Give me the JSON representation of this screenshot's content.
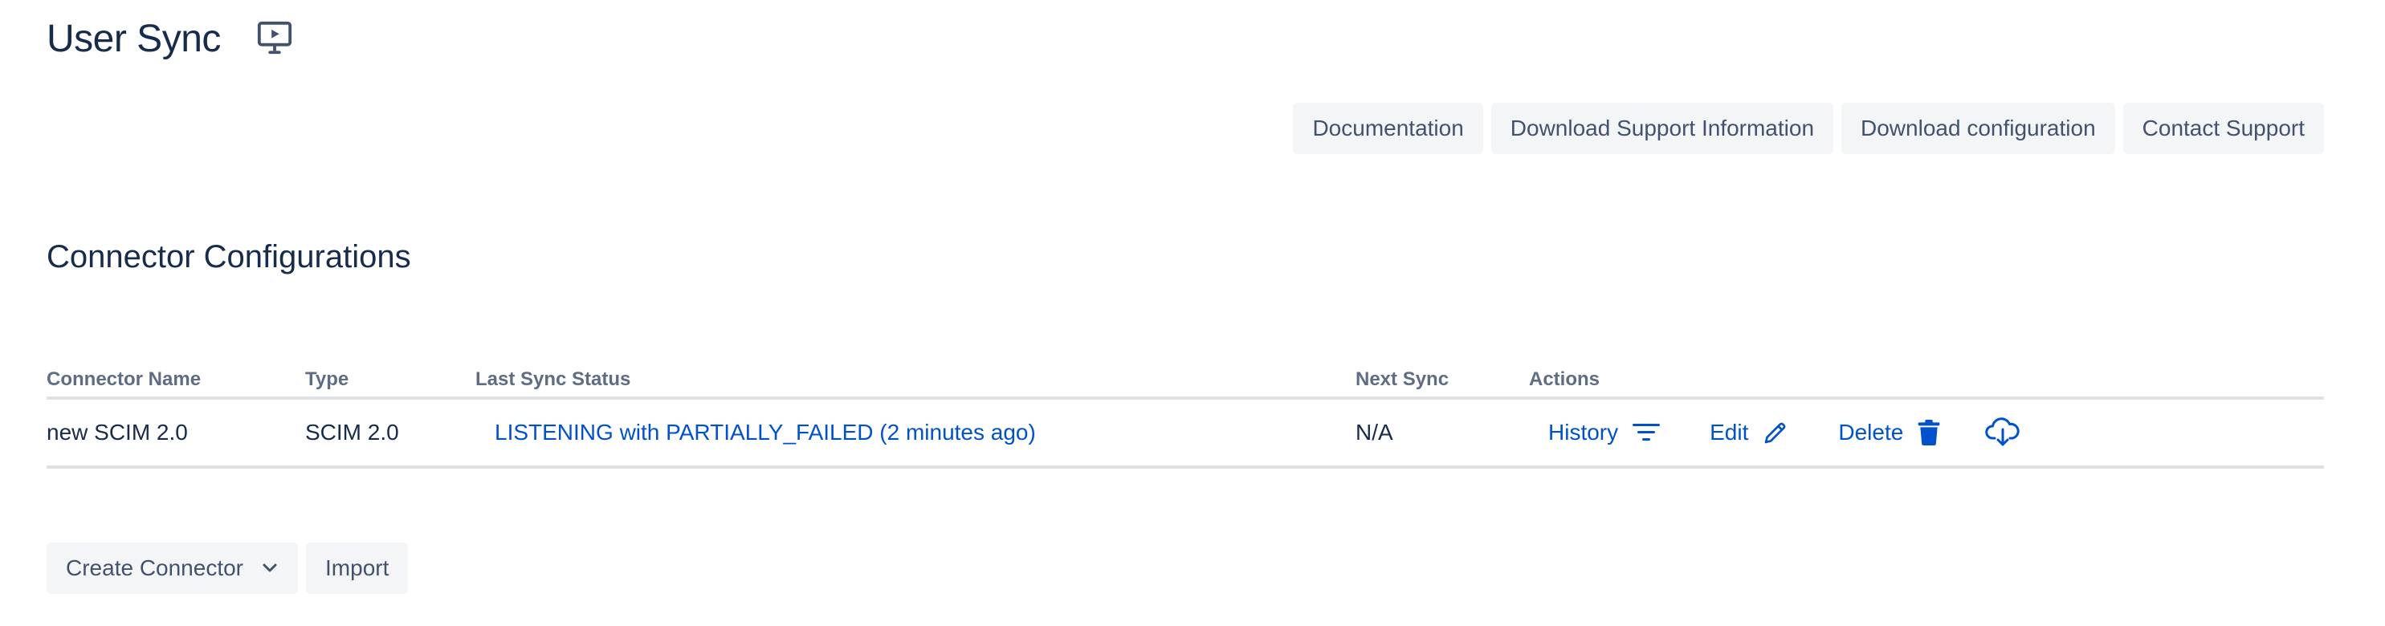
{
  "header": {
    "title": "User Sync",
    "title_icon": "presentation-play-icon"
  },
  "toolbar": {
    "documentation": "Documentation",
    "download_support": "Download Support Information",
    "download_config": "Download configuration",
    "contact_support": "Contact Support"
  },
  "section": {
    "title": "Connector Configurations"
  },
  "table": {
    "columns": [
      "Connector Name",
      "Type",
      "Last Sync Status",
      "Next Sync",
      "Actions"
    ],
    "rows": [
      {
        "name": "new SCIM 2.0",
        "type": "SCIM 2.0",
        "status": "LISTENING with PARTIALLY_FAILED (2 minutes ago)",
        "next_sync": "N/A",
        "actions": {
          "history": "History",
          "edit": "Edit",
          "delete": "Delete"
        }
      }
    ]
  },
  "footer": {
    "create_connector": "Create Connector",
    "import": "Import"
  },
  "colors": {
    "link": "#0052cc",
    "text": "#172b4d",
    "muted": "#5e6c84",
    "button_bg": "#f4f5f7",
    "divider": "#dfe1e6"
  }
}
